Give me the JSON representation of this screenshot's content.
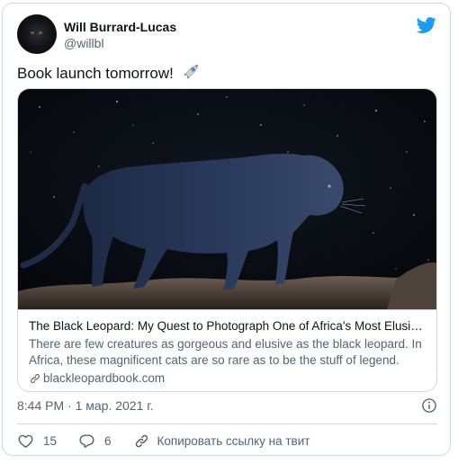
{
  "author": {
    "display_name": "Will Burrard-Lucas",
    "handle": "@willbl"
  },
  "tweet": {
    "text": "Book launch tomorrow!",
    "emoji": "rocket-icon"
  },
  "card": {
    "image_alt": "black leopard at night under starry sky",
    "title": "The Black Leopard: My Quest to Photograph One of Africa's Most Elusive…",
    "description": "There are few creatures as gorgeous and elusive as the black leopard. In Africa, these magnificent cats are so rare as to be the stuff of legend. This…",
    "domain": "blackleopardbook.com"
  },
  "meta": {
    "timestamp": "8:44 PM · 1 мар. 2021 г."
  },
  "actions": {
    "likes": "15",
    "replies": "6",
    "copy_link_label": "Копировать ссылку на твит"
  },
  "colors": {
    "brand": "#1d9bf0",
    "secondary_text": "#536471",
    "border": "#cfd9de"
  },
  "icons": [
    "twitter-bird-icon",
    "rocket-icon",
    "link-icon",
    "info-icon",
    "heart-icon",
    "reply-icon",
    "copy-link-icon"
  ]
}
